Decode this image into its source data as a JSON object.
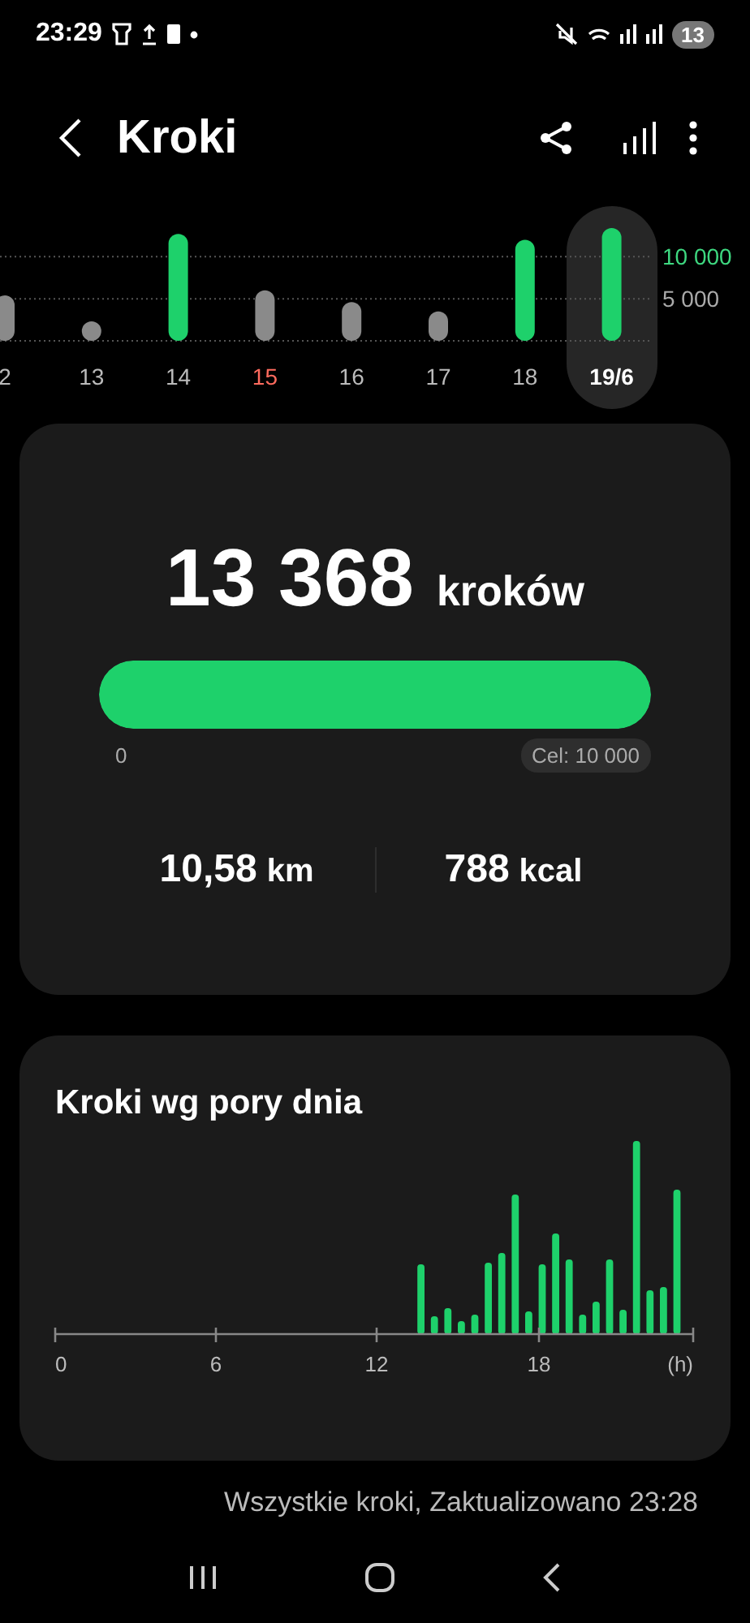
{
  "status_bar": {
    "time": "23:29",
    "notification_count": "13"
  },
  "header": {
    "title": "Kroki"
  },
  "weekly_chart": {
    "chart_data": {
      "type": "bar",
      "categories": [
        "2",
        "13",
        "14",
        "15",
        "16",
        "17",
        "18",
        "19/6"
      ],
      "values": [
        5400,
        2300,
        12700,
        6000,
        4600,
        3500,
        12000,
        13400
      ],
      "ylim": [
        0,
        13500
      ],
      "yticks": [
        {
          "value": 5000,
          "label": "5 000"
        },
        {
          "value": 10000,
          "label": "10 000"
        }
      ]
    },
    "days": [
      {
        "selected": false,
        "weekend": false,
        "color": "#8a8a8a"
      },
      {
        "selected": false,
        "weekend": false,
        "color": "#8a8a8a"
      },
      {
        "selected": false,
        "weekend": false,
        "color": "#1ed16b"
      },
      {
        "selected": false,
        "weekend": true,
        "color": "#8a8a8a"
      },
      {
        "selected": false,
        "weekend": false,
        "color": "#8a8a8a"
      },
      {
        "selected": false,
        "weekend": false,
        "color": "#8a8a8a"
      },
      {
        "selected": false,
        "weekend": false,
        "color": "#1ed16b"
      },
      {
        "selected": true,
        "weekend": false,
        "color": "#1ed16b"
      }
    ]
  },
  "summary": {
    "steps": "13 368",
    "steps_unit": "kroków",
    "level": 1,
    "start": "0",
    "goal": "Cel: 10 000",
    "stats": [
      {
        "value": "10,58",
        "unit": "km"
      },
      {
        "value": "788",
        "unit": "kcal"
      }
    ]
  },
  "hourly": {
    "title": "Kroki wg pory dnia",
    "axis_labels": [
      "0",
      "6",
      "12",
      "18",
      "(h)"
    ]
  },
  "footer": "Wszystkie kroki, Zaktualizowano 23:28"
}
